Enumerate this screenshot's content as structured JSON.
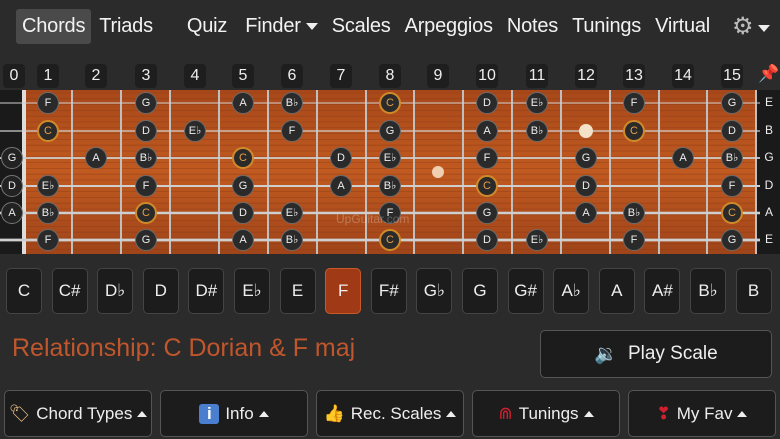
{
  "nav": {
    "items": [
      {
        "label": "Chords",
        "active": true,
        "caret": false
      },
      {
        "label": "Triads",
        "active": false,
        "caret": false
      },
      {
        "label": "Quiz",
        "active": false,
        "caret": false
      },
      {
        "label": "Finder",
        "active": false,
        "caret": true
      },
      {
        "label": "Scales",
        "active": false,
        "caret": false
      },
      {
        "label": "Arpeggios",
        "active": false,
        "caret": false
      },
      {
        "label": "Notes",
        "active": false,
        "caret": false
      },
      {
        "label": "Tunings",
        "active": false,
        "caret": false
      },
      {
        "label": "Virtual",
        "active": false,
        "caret": false
      }
    ],
    "settings_icon": "gear-icon",
    "help_label": "?"
  },
  "fret_numbers": [
    "0",
    "1",
    "2",
    "3",
    "4",
    "5",
    "6",
    "7",
    "8",
    "9",
    "10",
    "11",
    "12",
    "13",
    "14",
    "15"
  ],
  "tuning": [
    "E",
    "B",
    "G",
    "D",
    "A",
    "E"
  ],
  "open_strings": [
    "",
    "",
    "G",
    "D",
    "A",
    ""
  ],
  "fretboard": {
    "strings": [
      [
        null,
        "F",
        null,
        "G",
        null,
        "A",
        "B♭",
        null,
        "C",
        null,
        "D",
        "E♭",
        null,
        "F",
        null,
        "G"
      ],
      [
        null,
        "C",
        null,
        "D",
        "E♭",
        null,
        "F",
        null,
        "G",
        null,
        "A",
        "B♭",
        "•",
        "C",
        null,
        "D"
      ],
      [
        null,
        null,
        "A",
        "B♭",
        null,
        "C",
        null,
        "D",
        "E♭",
        null,
        "F",
        null,
        "G",
        null,
        "A",
        "B♭"
      ],
      [
        null,
        "E♭",
        null,
        "F",
        null,
        "G",
        null,
        "A",
        "B♭",
        null,
        "C",
        null,
        "D",
        null,
        null,
        "F"
      ],
      [
        null,
        "B♭",
        null,
        "C",
        null,
        "D",
        "E♭",
        null,
        "F",
        null,
        "G",
        null,
        "A",
        "B♭",
        null,
        "C"
      ],
      [
        null,
        "F",
        null,
        "G",
        null,
        "A",
        "B♭",
        null,
        "C",
        null,
        "D",
        "E♭",
        null,
        "F",
        null,
        "G"
      ]
    ],
    "root_note": "C",
    "watermark": "UpGuitar.com"
  },
  "keys": [
    "C",
    "C#",
    "D♭",
    "D",
    "D#",
    "E♭",
    "E",
    "F",
    "F#",
    "G♭",
    "G",
    "G#",
    "A♭",
    "A",
    "A#",
    "B♭",
    "B"
  ],
  "selected_key": "F",
  "relationship": "Relationship: C Dorian & F maj",
  "play_button": {
    "label": "Play Scale",
    "icon": "speaker-icon"
  },
  "bottom_buttons": [
    {
      "label": "Chord Types",
      "icon": "tag-icon"
    },
    {
      "label": "Info",
      "icon": "info-icon"
    },
    {
      "label": "Rec. Scales",
      "icon": "thumbs-up-icon"
    },
    {
      "label": "Tunings",
      "icon": "magnet-icon"
    },
    {
      "label": "My Fav",
      "icon": "heart-exclaim-icon"
    }
  ],
  "colors": {
    "accent": "#a03a16",
    "relationship_text": "#c0562c",
    "root_ring": "#d08a2a",
    "wood": "#b5521c"
  }
}
